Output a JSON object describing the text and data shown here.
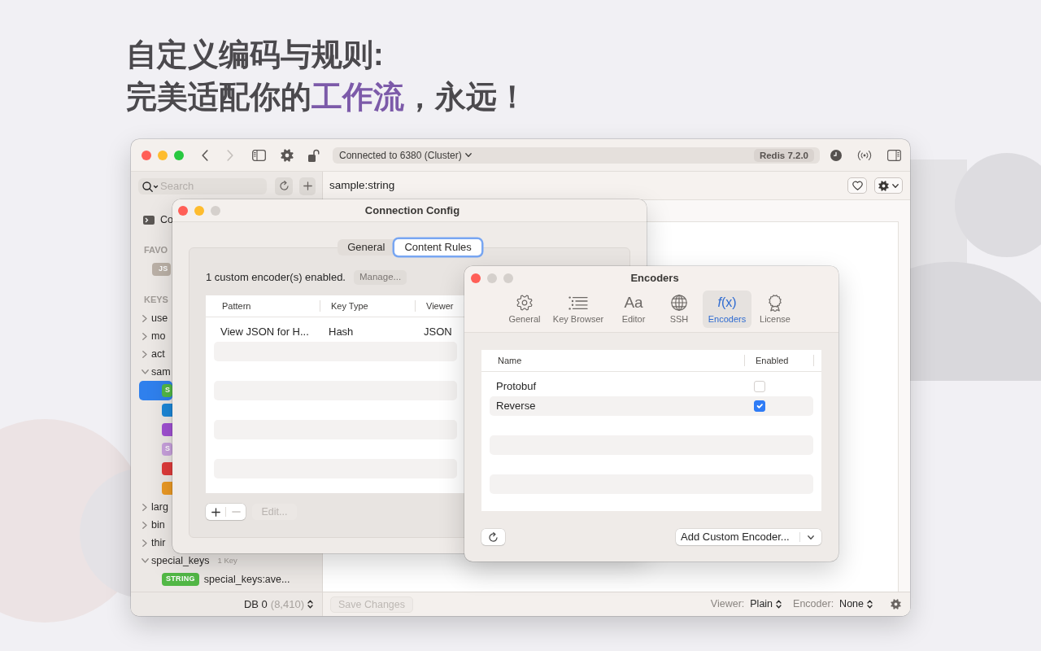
{
  "headline": [
    [
      {
        "text": "自定义编码与规则:",
        "accent": false
      }
    ],
    [
      {
        "text": "完美适配你的",
        "accent": false
      },
      {
        "text": "工作流",
        "accent": true
      },
      {
        "text": "，永远！",
        "accent": false
      }
    ]
  ],
  "main_window": {
    "window_buttons": [
      {
        "kind": "close",
        "enabled": true
      },
      {
        "kind": "minimize",
        "enabled": true
      },
      {
        "kind": "zoom",
        "enabled": true
      }
    ],
    "navigation": [
      {
        "kind": "back",
        "disabled": false
      },
      {
        "kind": "forward",
        "disabled": true
      }
    ],
    "connection": {
      "label": "Connected to 6380 (Cluster)",
      "server": "Redis 7.2.0"
    },
    "sidebar": {
      "search_placeholder": "Search",
      "items": [
        {
          "kind": "connection",
          "label": "Co"
        },
        {
          "kind": "section",
          "label": "FAVO"
        },
        {
          "kind": "favorite",
          "tag": "JS",
          "color": "#bbb1a7"
        },
        {
          "kind": "section",
          "label": "KEYS"
        },
        {
          "kind": "group",
          "label": "use",
          "expanded": false
        },
        {
          "kind": "group",
          "label": "mo",
          "expanded": false
        },
        {
          "kind": "group",
          "label": "act",
          "expanded": false
        },
        {
          "kind": "group",
          "label": "sam",
          "expanded": true,
          "children": [
            {
              "kind": "key",
              "tag": "S",
              "color": "#52b846",
              "selected": true
            },
            {
              "kind": "key",
              "color": "#1c87d8",
              "selected": false
            },
            {
              "kind": "key",
              "color": "#a050d3",
              "selected": false
            },
            {
              "kind": "key",
              "tag": "S",
              "color": "#c8a1dd",
              "selected": false
            },
            {
              "kind": "key",
              "color": "#e03b3b",
              "selected": false
            },
            {
              "kind": "key",
              "color": "#ec9a24",
              "selected": false
            }
          ]
        },
        {
          "kind": "group",
          "label": "larg",
          "expanded": false
        },
        {
          "kind": "group",
          "label": "bin",
          "expanded": false
        },
        {
          "kind": "group",
          "label": "thir",
          "expanded": false
        },
        {
          "kind": "group",
          "label": "special_keys",
          "count": "1 Key",
          "expanded": true,
          "children": [
            {
              "kind": "key",
              "tag": "STRING",
              "color": "#52b846",
              "label": "special_keys:ave...",
              "selected": false
            }
          ]
        }
      ]
    },
    "key_title": "sample:string",
    "status_bar": {
      "database": "DB 0",
      "key_count": "(8,410)",
      "save_button": {
        "label": "Save Changes",
        "disabled": true
      },
      "viewer": {
        "label": "Viewer:",
        "value": "Plain"
      },
      "encoder": {
        "label": "Encoder:",
        "value": "None"
      }
    }
  },
  "config_window": {
    "window_buttons": [
      {
        "kind": "close",
        "enabled": true
      },
      {
        "kind": "minimize",
        "enabled": true
      },
      {
        "kind": "zoom",
        "enabled": false
      }
    ],
    "title": "Connection Config",
    "tabs": [
      {
        "label": "General",
        "selected": false
      },
      {
        "label": "Content Rules",
        "selected": true
      }
    ],
    "summary": "1 custom encoder(s) enabled.",
    "manage_button": "Manage...",
    "table": {
      "columns": [
        "Pattern",
        "Key Type",
        "Viewer"
      ],
      "rows": [
        [
          "View JSON for H...",
          "Hash",
          "JSON"
        ]
      ]
    },
    "rule_buttons": [
      {
        "kind": "add",
        "disabled": false
      },
      {
        "kind": "remove",
        "disabled": true
      }
    ],
    "edit_button": {
      "label": "Edit...",
      "disabled": true
    }
  },
  "encoders_window": {
    "window_buttons": [
      {
        "kind": "close",
        "enabled": true
      },
      {
        "kind": "minimize",
        "enabled": false
      },
      {
        "kind": "zoom",
        "enabled": false
      }
    ],
    "title": "Encoders",
    "tabs": [
      {
        "label": "General",
        "selected": false
      },
      {
        "label": "Key Browser",
        "selected": false
      },
      {
        "glyph": "Aa",
        "label": "Editor",
        "selected": false
      },
      {
        "label": "SSH",
        "selected": false
      },
      {
        "glyph": "*f*(x)",
        "label": "Encoders",
        "selected": true
      },
      {
        "label": "License",
        "selected": false
      }
    ],
    "table": {
      "columns": [
        "Name",
        "Enabled"
      ],
      "rows": [
        {
          "name": "Protobuf",
          "enabled": false
        },
        {
          "name": "Reverse",
          "enabled": true
        }
      ]
    },
    "add_button": "Add Custom Encoder..."
  }
}
